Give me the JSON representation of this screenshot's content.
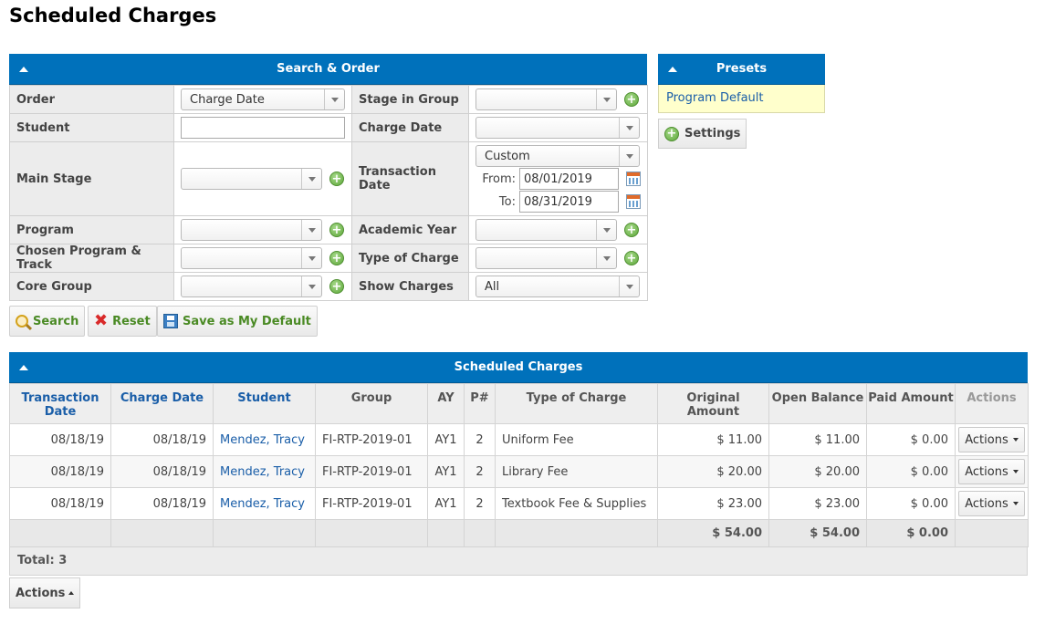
{
  "page": {
    "title": "Scheduled Charges"
  },
  "search": {
    "header": "Search & Order",
    "labels": {
      "order": "Order",
      "stage_in_group": "Stage in Group",
      "student": "Student",
      "charge_date": "Charge Date",
      "main_stage": "Main Stage",
      "transaction_date": "Transaction Date",
      "program": "Program",
      "academic_year": "Academic Year",
      "chosen_program_track": "Chosen Program & Track",
      "type_of_charge": "Type of Charge",
      "core_group": "Core Group",
      "show_charges": "Show Charges"
    },
    "values": {
      "order": "Charge Date",
      "stage_in_group": "",
      "student": "",
      "charge_date": "",
      "main_stage": "",
      "transaction_date_mode": "Custom",
      "from_label": "From:",
      "from": "08/01/2019",
      "to_label": "To:",
      "to": "08/31/2019",
      "program": "",
      "academic_year": "",
      "chosen_program_track": "",
      "type_of_charge": "",
      "core_group": "",
      "show_charges": "All"
    },
    "buttons": {
      "search": "Search",
      "reset": "Reset",
      "save_default": "Save as My Default"
    }
  },
  "presets": {
    "header": "Presets",
    "items": [
      "Program Default"
    ],
    "settings": "Settings"
  },
  "results": {
    "header": "Scheduled Charges",
    "columns": [
      "Transaction Date",
      "Charge Date",
      "Student",
      "Group",
      "AY",
      "P#",
      "Type of Charge",
      "Original Amount",
      "Open Balance",
      "Paid Amount",
      "Actions"
    ],
    "rows": [
      {
        "transaction_date": "08/18/19",
        "charge_date": "08/18/19",
        "student": "Mendez, Tracy",
        "group": "FI-RTP-2019-01",
        "ay": "AY1",
        "p": "2",
        "type": "Uniform Fee",
        "original": "$ 11.00",
        "open": "$ 11.00",
        "paid": "$ 0.00",
        "actions": "Actions"
      },
      {
        "transaction_date": "08/18/19",
        "charge_date": "08/18/19",
        "student": "Mendez, Tracy",
        "group": "FI-RTP-2019-01",
        "ay": "AY1",
        "p": "2",
        "type": "Library Fee",
        "original": "$ 20.00",
        "open": "$ 20.00",
        "paid": "$ 0.00",
        "actions": "Actions"
      },
      {
        "transaction_date": "08/18/19",
        "charge_date": "08/18/19",
        "student": "Mendez, Tracy",
        "group": "FI-RTP-2019-01",
        "ay": "AY1",
        "p": "2",
        "type": "Textbook Fee & Supplies",
        "original": "$ 23.00",
        "open": "$ 23.00",
        "paid": "$ 0.00",
        "actions": "Actions"
      }
    ],
    "totals": {
      "original": "$ 54.00",
      "open": "$ 54.00",
      "paid": "$ 0.00"
    },
    "total_count": "Total: 3"
  },
  "bottom": {
    "actions": "Actions"
  }
}
